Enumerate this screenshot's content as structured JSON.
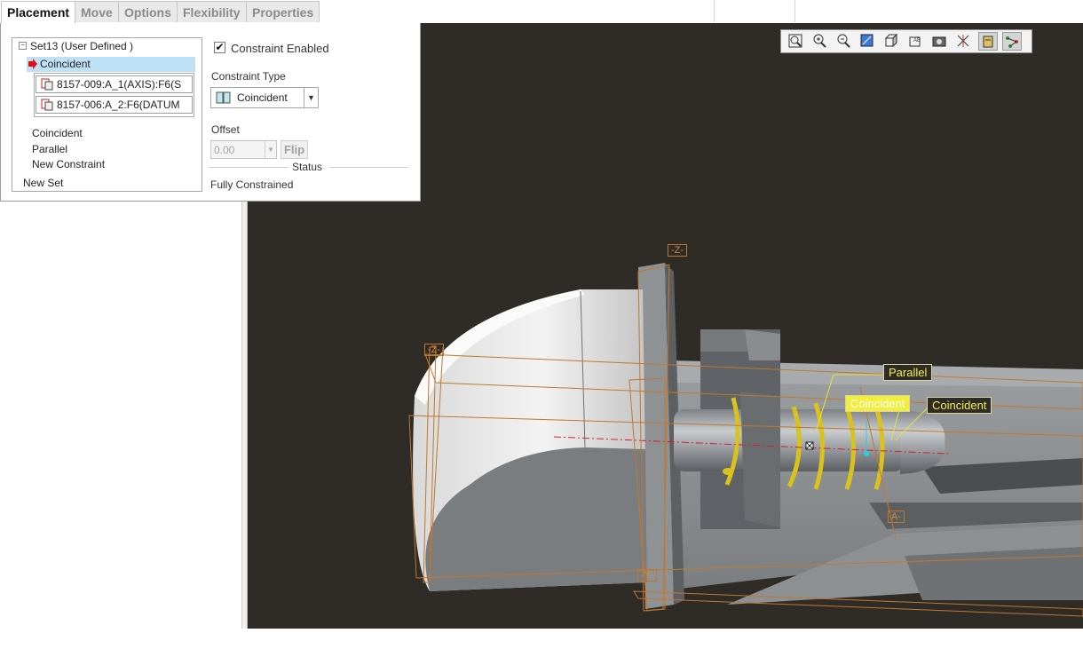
{
  "tabs": [
    {
      "label": "Placement",
      "active": true
    },
    {
      "label": "Move",
      "active": false
    },
    {
      "label": "Options",
      "active": false
    },
    {
      "label": "Flexibility",
      "active": false
    },
    {
      "label": "Properties",
      "active": false
    }
  ],
  "placement": {
    "set_title": "Set13 (User Defined )",
    "selected_constraint": "Coincident",
    "references": [
      "8157-009:A_1(AXIS):F6(S",
      "8157-006:A_2:F6(DATUM"
    ],
    "constraints": [
      "Coincident",
      "Parallel",
      "New Constraint"
    ],
    "new_set": "New Set",
    "enabled_label": "Constraint Enabled",
    "enabled": true,
    "type_label": "Constraint Type",
    "type_value": "Coincident",
    "offset_label": "Offset",
    "offset_value": "0.00",
    "flip_label": "Flip",
    "status_title": "Status",
    "status_value": "Fully Constrained"
  },
  "view_toolbar": {
    "icons": [
      "refit-icon",
      "zoom-in-icon",
      "zoom-out-icon",
      "repaint-icon",
      "display-style-icon",
      "saved-views-icon",
      "view-manager-icon",
      "datum-display-icon",
      "spin-center-icon",
      "annotation-display-icon"
    ]
  },
  "annotations": {
    "parallel": "Parallel",
    "coincident_a": "Coincident",
    "coincident_b": "Coincident"
  },
  "datum_tags": {
    "z_top": "-Z-",
    "z_left": "-Z-",
    "y_bottom": "-Y-",
    "a_axis": "A-"
  },
  "colors": {
    "viewport_bg": "#2f2c27",
    "selection": "#bfe1f8",
    "spring": "#d9c21c",
    "annotation": "#f4ef4a",
    "datum": "#c0782e"
  }
}
